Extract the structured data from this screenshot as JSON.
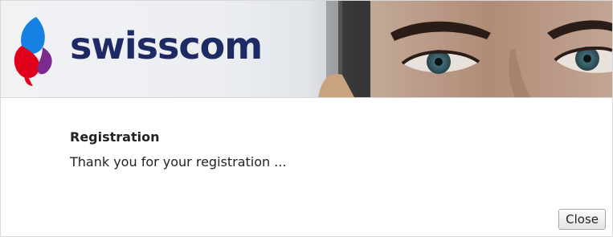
{
  "banner": {
    "brand": "swisscom",
    "logo_icon": "swisscom-lifeform-icon",
    "brand_color": "#1d2a63",
    "logo_colors": [
      "#e1001a",
      "#1781e3",
      "#7b2b8d"
    ]
  },
  "dialog": {
    "title": "Registration",
    "message": "Thank you for your registration ...",
    "close_label": "Close"
  }
}
